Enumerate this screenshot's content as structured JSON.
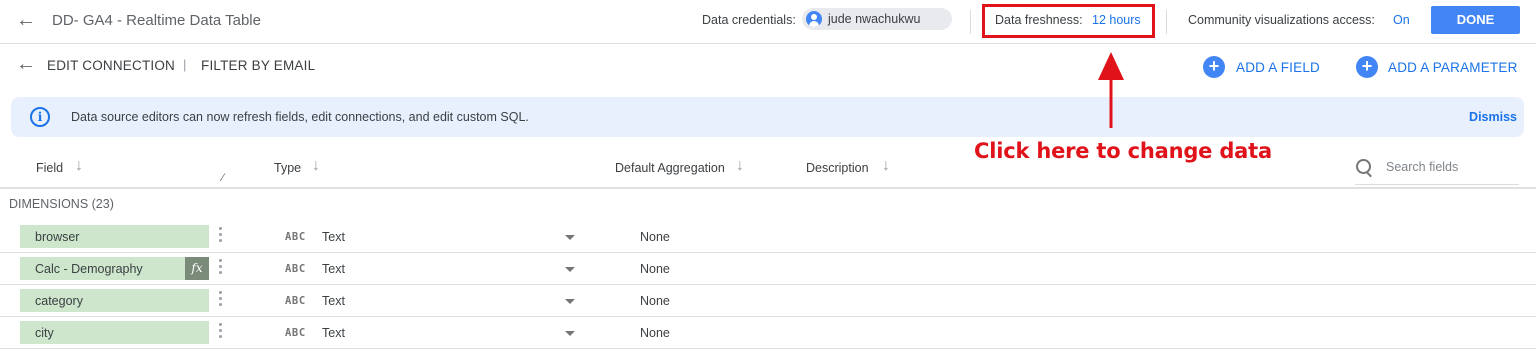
{
  "header": {
    "title": "DD- GA4 - Realtime Data Table",
    "credentials_label": "Data credentials:",
    "credentials_user": "jude nwachukwu",
    "freshness_label": "Data freshness:",
    "freshness_value": "12 hours",
    "community_label": "Community visualizations access:",
    "community_value": "On",
    "done_label": "DONE"
  },
  "toolbar": {
    "edit_connection": "EDIT CONNECTION",
    "separator": "|",
    "filter_by_email": "FILTER BY EMAIL",
    "add_field": "ADD A FIELD",
    "add_parameter": "ADD A PARAMETER"
  },
  "banner": {
    "message": "Data source editors can now refresh fields, edit connections, and edit custom SQL.",
    "dismiss": "Dismiss"
  },
  "annotation": {
    "text": "Click here to change data",
    "color": "#e0121a"
  },
  "columns": {
    "field": "Field",
    "type": "Type",
    "default_aggregation": "Default Aggregation",
    "description": "Description"
  },
  "search": {
    "placeholder": "Search fields"
  },
  "section": {
    "title": "DIMENSIONS (23)"
  },
  "rows": [
    {
      "name": "browser",
      "type_icon": "ABC",
      "type": "Text",
      "aggregation": "None",
      "calculated": false
    },
    {
      "name": "Calc - Demography",
      "type_icon": "ABC",
      "type": "Text",
      "aggregation": "None",
      "calculated": true,
      "badge": "fx"
    },
    {
      "name": "category",
      "type_icon": "ABC",
      "type": "Text",
      "aggregation": "None",
      "calculated": false
    },
    {
      "name": "city",
      "type_icon": "ABC",
      "type": "Text",
      "aggregation": "None",
      "calculated": false
    }
  ],
  "colors": {
    "accent": "#1a73e8",
    "done_button": "#4285f4",
    "dimension_pill": "#cde6cc",
    "banner_bg": "#e8f0fe"
  }
}
